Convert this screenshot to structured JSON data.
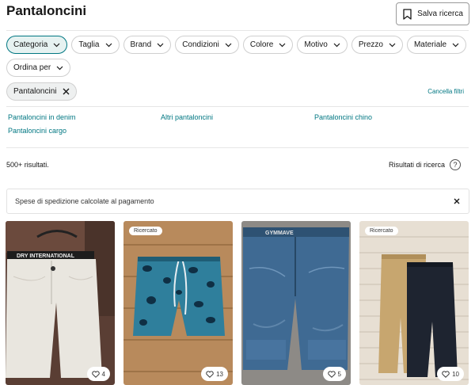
{
  "header": {
    "title": "Pantaloncini",
    "save_search_label": "Salva ricerca"
  },
  "filters": [
    {
      "label": "Categoria",
      "active": true
    },
    {
      "label": "Taglia"
    },
    {
      "label": "Brand"
    },
    {
      "label": "Condizioni"
    },
    {
      "label": "Colore"
    },
    {
      "label": "Motivo"
    },
    {
      "label": "Prezzo"
    },
    {
      "label": "Materiale"
    },
    {
      "label": "Ordina per"
    }
  ],
  "applied_filter": {
    "label": "Pantaloncini"
  },
  "clear_filters_label": "Cancella filtri",
  "subcategories": [
    "Pantaloncini in denim",
    "Altri pantaloncini",
    "Pantaloncini chino",
    "Pantaloncini cargo"
  ],
  "results": {
    "count_label": "500+ risultati.",
    "search_results_label": "Risultati di ricerca",
    "help_icon_glyph": "?"
  },
  "notice": {
    "text": "Spese di spedizione calcolate al pagamento"
  },
  "listings": [
    {
      "badge": "",
      "favorites": "4",
      "image": "white-shorts-photo"
    },
    {
      "badge": "Ricercato",
      "favorites": "13",
      "image": "leopard-swim-shorts-photo"
    },
    {
      "badge": "",
      "favorites": "5",
      "image": "denim-shorts-photo"
    },
    {
      "badge": "Ricercato",
      "favorites": "10",
      "image": "chino-shorts-pair-photo"
    }
  ],
  "colors": {
    "accent": "#007782",
    "text": "#171717",
    "border": "#e6e6e6"
  }
}
